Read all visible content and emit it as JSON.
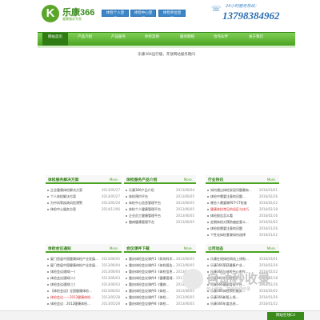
{
  "header": {
    "logo_letter": "K",
    "logo_name": "乐康366",
    "logo_sub": "健康服务专家",
    "buttons": [
      "体检个人登录",
      "体检中心登录",
      "体检单位登录"
    ],
    "hotline_label": "24小时服务热线：",
    "hotline_number": "13798384962"
  },
  "nav": {
    "items": [
      "网站首页",
      "产品介绍",
      "产品服务",
      "体检案例",
      "服务网络",
      "合作伙伴",
      "关于我们"
    ]
  },
  "banner": {
    "caption": "乐康366运行缓，开放网站服务期间"
  },
  "panels": [
    {
      "title": "体检服务解决方案",
      "more": "More.",
      "items": [
        {
          "text": "企业健康体检解决方案",
          "date": "2013/05/27",
          "red": false
        },
        {
          "text": "个人体检解决方案",
          "date": "2013/05/27",
          "red": false
        },
        {
          "text": "为中风等疾病风险预警",
          "date": "2013/05/29",
          "red": false
        },
        {
          "text": "体检中心服务方案",
          "date": "2014/11/06",
          "red": false
        }
      ]
    },
    {
      "title": "体检服务产品介绍",
      "more": "More.",
      "items": [
        {
          "text": "乐康366产品介绍",
          "date": "2013/06/04",
          "red": false
        },
        {
          "text": "体检预约平台",
          "date": "2013/06/05",
          "red": false
        },
        {
          "text": "体检中心信息管理平台",
          "date": "2013/06/05",
          "red": false
        },
        {
          "text": "体检个人健康管理平台",
          "date": "2013/06/05",
          "red": false
        },
        {
          "text": "企业员工健康管理平台",
          "date": "2013/06/05",
          "red": false
        },
        {
          "text": "慢病健康管理平台",
          "date": "2013/06/05",
          "red": false
        }
      ]
    },
    {
      "title": "行业快讯",
      "more": "More.",
      "items": [
        {
          "text": "如何通过体检发现问题最有...",
          "date": "2016/03/01",
          "red": false
        },
        {
          "text": "体检中需要注意的问题...",
          "date": "2016/02/26",
          "red": false
        },
        {
          "text": "哪些人需要做PET-CT检查",
          "date": "2016/02/22",
          "red": false
        },
        {
          "text": "健康体检常见的误区与技巧",
          "date": "2016/02/18",
          "red": true
        },
        {
          "text": "体检报告怎么看",
          "date": "2016/02/16",
          "red": false
        },
        {
          "text": "定期体检对预防癌症意义...",
          "date": "2016/02/02",
          "red": false
        },
        {
          "text": "体检前需要注意的问题",
          "date": "2016/01/26",
          "red": false
        },
        {
          "text": "个性化体检套餐如何选择",
          "date": "2016/01/22",
          "red": false
        }
      ]
    },
    {
      "title": "体检会议通知",
      "more": "More.",
      "items": [
        {
          "text": "厦门首届中国健康体检产业发展...",
          "date": "2013/06/05",
          "red": false
        },
        {
          "text": "厦门首届中国健康体检产业发展...",
          "date": "2013/06/04",
          "red": false
        },
        {
          "text": "体检会议通知(一)",
          "date": "2013/06/04",
          "red": false
        },
        {
          "text": "体检会议通知(二)",
          "date": "2013/06/03",
          "red": false
        },
        {
          "text": "体检会议通知(三)",
          "date": "2013/06/03",
          "red": false
        },
        {
          "text": "【体检会议】全国健康体检...",
          "date": "2013/06/02",
          "red": false
        },
        {
          "text": "体检会议——2012健康体检...",
          "date": "2013/05/28",
          "red": true
        },
        {
          "text": "体检会议：2012健康体检...",
          "date": "2013/05/28",
          "red": false
        }
      ]
    },
    {
      "title": "会议课件下载",
      "more": "More.",
      "items": [
        {
          "text": "重庆体检会议课件1《如何科学...",
          "date": "2013/06/05",
          "red": false
        },
        {
          "text": "重庆体检会议课件2《体检报告...",
          "date": "2013/06/05",
          "red": false
        },
        {
          "text": "重庆体检会议课件3《体检信息...",
          "date": "2013/06/05",
          "red": false
        },
        {
          "text": "重庆体检会议课件4《健康管理...",
          "date": "2013/06/05",
          "red": false
        },
        {
          "text": "重庆体检会议课件5《慢病...",
          "date": "2013/06/05",
          "red": false
        },
        {
          "text": "重庆体检会议课件6《体检...",
          "date": "2013/06/05",
          "red": false
        },
        {
          "text": "重庆体检会议课件7《体检...",
          "date": "2013/06/05",
          "red": false
        },
        {
          "text": "重庆体检会议课件8《体检...",
          "date": "2013/06/05",
          "red": false
        }
      ]
    },
    {
      "title": "公司动态",
      "more": "More.",
      "items": [
        {
          "text": "乐康在线体检网站上线啦...",
          "date": "2016/03/01",
          "red": false
        },
        {
          "text": "乐康366荣获健康产业...",
          "date": "2016/02/26",
          "red": false
        },
        {
          "text": "乐康366与体检中心合作...",
          "date": "2016/02/22",
          "red": false
        },
        {
          "text": "乐康366参加健康产业...",
          "date": "2016/02/18",
          "red": false
        },
        {
          "text": "乐康366健康管理平台...",
          "date": "2016/02/16",
          "red": false
        },
        {
          "text": "乐康366体检预约服务...",
          "date": "2016/02/02",
          "red": false
        },
        {
          "text": "乐康366新版上线...",
          "date": "2016/01/26",
          "red": false
        },
        {
          "text": "乐康366年度总结...",
          "date": "2016/01/22",
          "red": false
        }
      ]
    }
  ],
  "watermark": {
    "text": "自动秒收录",
    "sub": "放上链接，等待自动收录"
  },
  "corner_button": "网站在线Cd",
  "colors": {
    "brand_green": "#4aa321",
    "nav_active": "#2f7d12",
    "button_blue": "#3b86c8",
    "alert_red": "#d4282a"
  }
}
